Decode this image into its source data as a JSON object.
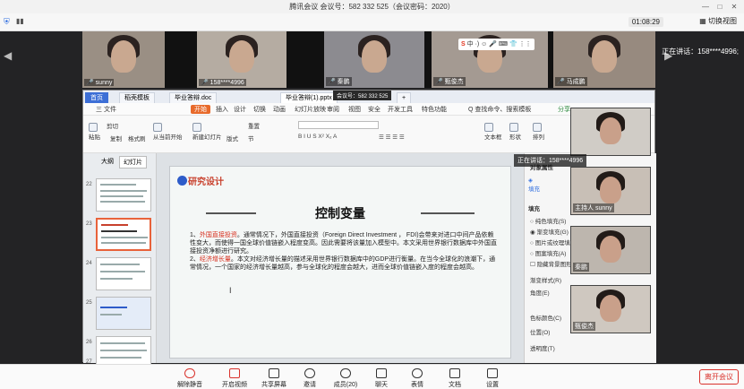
{
  "window": {
    "title": "腾讯会议 会议号：582 332 525（会议密码：2020）"
  },
  "header": {
    "timer": "01:08:29",
    "view_label": "切换视图"
  },
  "speaker_label": "正在讲话：158****4996;",
  "participants": [
    {
      "name": "sunny"
    },
    {
      "name": "158****4996"
    },
    {
      "name": "秦鹏"
    },
    {
      "name": "甄俊杰"
    },
    {
      "name": "马成鹏"
    }
  ],
  "ime": {
    "logo": "S",
    "label": "中 ·) ☺ 🎤 ⌨ 👕 ⋮⋮"
  },
  "meeting_tag": "会议号：582 332 525",
  "wps": {
    "tabs": [
      "首页",
      "稻壳模板",
      "毕业答辩.doc",
      "毕业答辩(1).pptx",
      "+"
    ],
    "menu": [
      "三 文件",
      "开始",
      "插入",
      "设计",
      "切换",
      "动画",
      "幻灯片放映",
      "审阅",
      "视图",
      "安全",
      "开发工具",
      "特色功能",
      "Q 查找命令、搜索模板",
      "分享"
    ],
    "ribbon": [
      "粘贴",
      "剪切",
      "复制",
      "格式刷",
      "从当前开始",
      "新建幻灯片",
      "版式",
      "节",
      "重置",
      "文本框",
      "形状",
      "排列"
    ],
    "panel_tabs": [
      "大纲",
      "幻灯片"
    ],
    "slide_numbers": [
      "22",
      "23",
      "24",
      "25",
      "26",
      "27"
    ],
    "slide": {
      "section": "研究设计",
      "title": "控制变量",
      "p1_lead": "1、",
      "p1_red": "外国直接投资",
      "p1_rest": "。通常情况下，外国直接投资（Foreign Direct Investment ， FDI)会带来对进口中间产品依赖性变大，而使得一国全球价值链嵌入程度变高。因此需要将该量加入模型中。本文采用世界银行数据库中外国直接投资净额进行研究。",
      "p2_lead": "2、",
      "p2_red": "经济增长量",
      "p2_rest": "。本文对经济增长量的描述采用世界银行数据库中的GDP进行衡量。在当今全球化的浪潮下，通常情况，一个国家的经济增长量越高，参与全球化的程度会越大，进而全球价值链嵌入度的程度会越高。"
    },
    "right_panel": {
      "section1": "对象属性",
      "fill_tab": "填充",
      "fill_head": "填充",
      "options": [
        "纯色填充(S)",
        "渐变填充(G)",
        "图片或纹理填充",
        "图案填充(A)",
        "隐藏背景图形"
      ],
      "labels": [
        "渐变样式(R)",
        "角度(E)",
        "色标颜色(C)",
        "位置(O)",
        "透明度(T)"
      ]
    }
  },
  "side_tiles": [
    {
      "name": ""
    },
    {
      "name": "主持人  sunny"
    },
    {
      "name": "秦鹏"
    },
    {
      "name": "甄俊杰"
    }
  ],
  "toast": "正在讲话：158****4996",
  "bottombar": {
    "items": [
      "解除静音",
      "开启视频",
      "共享屏幕",
      "邀请",
      "成员(20)",
      "聊天",
      "表情",
      "文档",
      "设置"
    ],
    "leave": "离开会议"
  }
}
